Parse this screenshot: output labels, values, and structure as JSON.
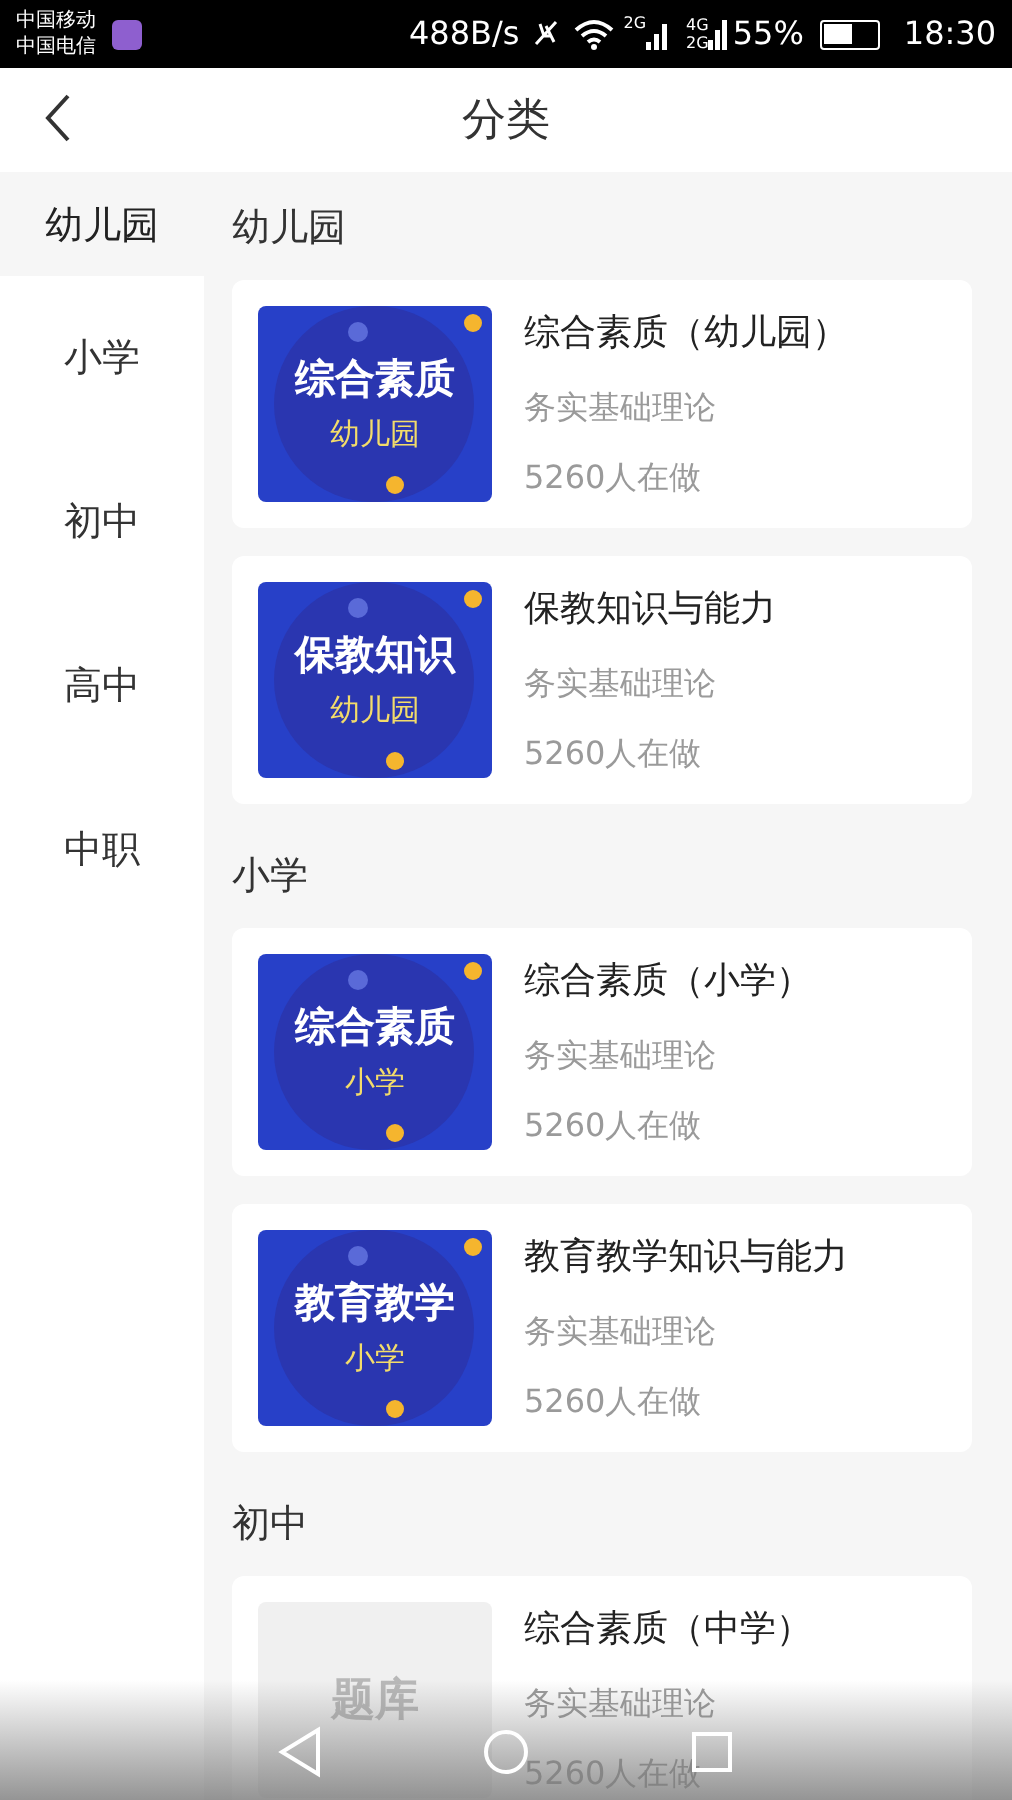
{
  "status_bar": {
    "carriers": [
      "中国移动",
      "中国电信"
    ],
    "speed": "488B/s",
    "sim1_network": "2G",
    "sim2_networks": [
      "4G",
      "2G"
    ],
    "battery_percent": "55%",
    "time": "18:30"
  },
  "header": {
    "title": "分类"
  },
  "sidebar": {
    "items": [
      {
        "label": "幼儿园",
        "selected": true
      },
      {
        "label": "小学",
        "selected": false
      },
      {
        "label": "初中",
        "selected": false
      },
      {
        "label": "高中",
        "selected": false
      },
      {
        "label": "中职",
        "selected": false
      }
    ]
  },
  "sections": [
    {
      "title": "幼儿园",
      "courses": [
        {
          "cover": {
            "kind": "cover",
            "title": "综合素质",
            "subtitle": "幼儿园"
          },
          "name": "综合素质（幼儿园）",
          "subject": "务实基础理论",
          "learners": "5260人在做"
        },
        {
          "cover": {
            "kind": "cover",
            "title": "保教知识",
            "subtitle": "幼儿园"
          },
          "name": "保教知识与能力",
          "subject": "务实基础理论",
          "learners": "5260人在做"
        }
      ]
    },
    {
      "title": "小学",
      "courses": [
        {
          "cover": {
            "kind": "cover",
            "title": "综合素质",
            "subtitle": "小学"
          },
          "name": "综合素质（小学）",
          "subject": "务实基础理论",
          "learners": "5260人在做"
        },
        {
          "cover": {
            "kind": "cover",
            "title": "教育教学",
            "subtitle": "小学"
          },
          "name": "教育教学知识与能力",
          "subject": "务实基础理论",
          "learners": "5260人在做"
        }
      ]
    },
    {
      "title": "初中",
      "courses": [
        {
          "cover": {
            "kind": "placeholder",
            "title": "题库"
          },
          "name": "综合素质（中学）",
          "subject": "务实基础理论",
          "learners": "5260人在做"
        }
      ]
    }
  ]
}
